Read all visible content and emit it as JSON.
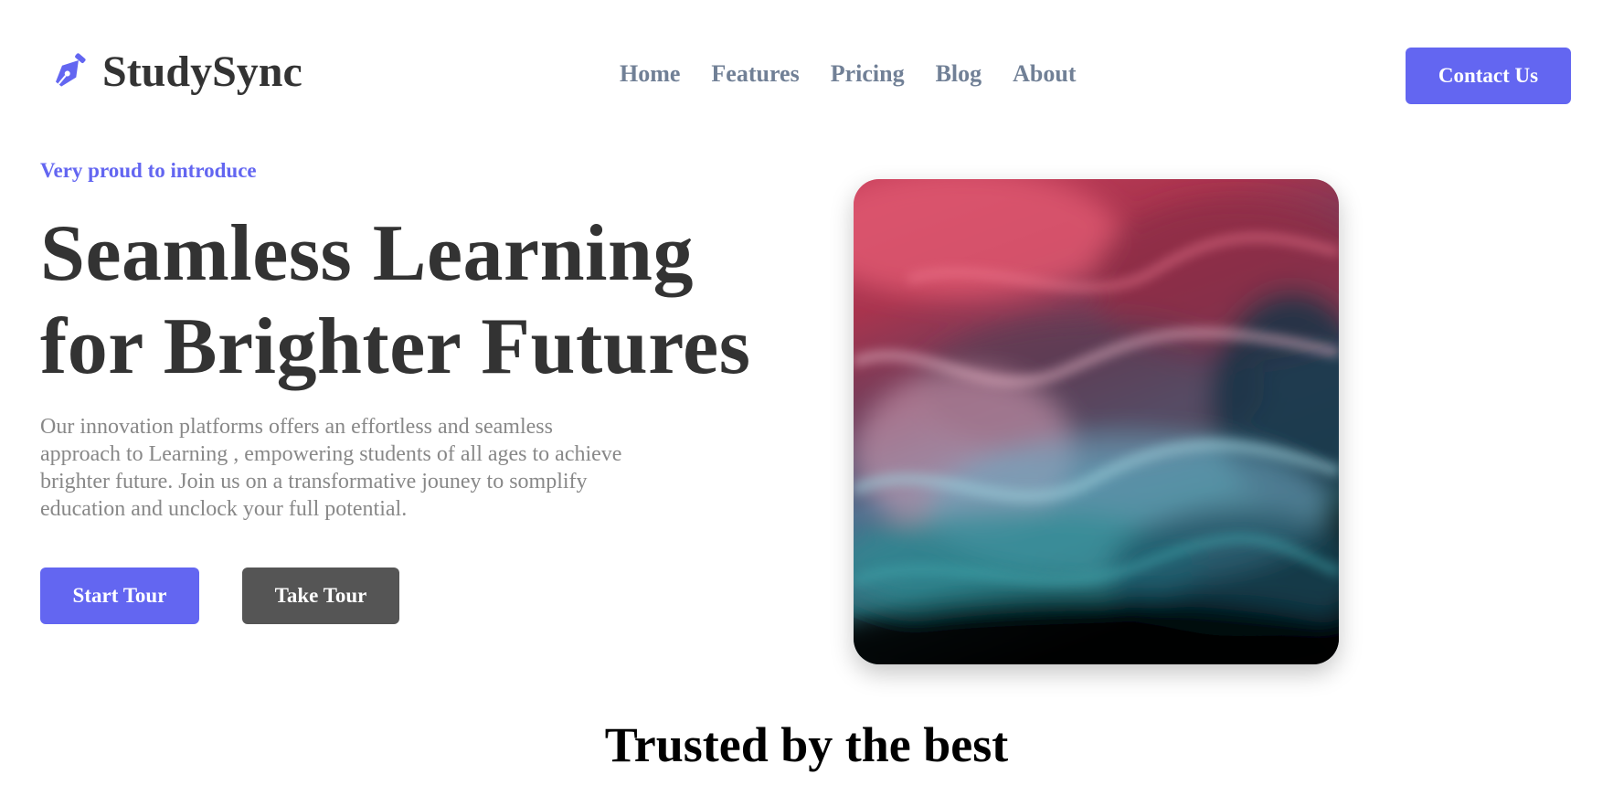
{
  "brand": {
    "name": "StudySync",
    "icon": "pen-nib-icon",
    "color": "#6366f1"
  },
  "nav": {
    "items": [
      {
        "label": "Home"
      },
      {
        "label": "Features"
      },
      {
        "label": "Pricing"
      },
      {
        "label": "Blog"
      },
      {
        "label": "About"
      }
    ],
    "contact_label": "Contact Us"
  },
  "hero": {
    "eyebrow": "Very proud to introduce",
    "title": "Seamless Learning for Brighter Futures",
    "description": "Our innovation platforms offers an effortless and seamless approach to Learning , empowering students of all ages to achieve brighter future. Join us on a transformative jouney to somplify education and unclock your full potential.",
    "primary_button": "Start Tour",
    "secondary_button": "Take Tour",
    "image": "abstract-fluid-art-image"
  },
  "trusted": {
    "heading": "Trusted by the best"
  },
  "colors": {
    "accent": "#6366f1",
    "text_dark": "#333333",
    "nav_text": "#718096",
    "secondary_button": "#555555",
    "body_text": "#888888"
  }
}
